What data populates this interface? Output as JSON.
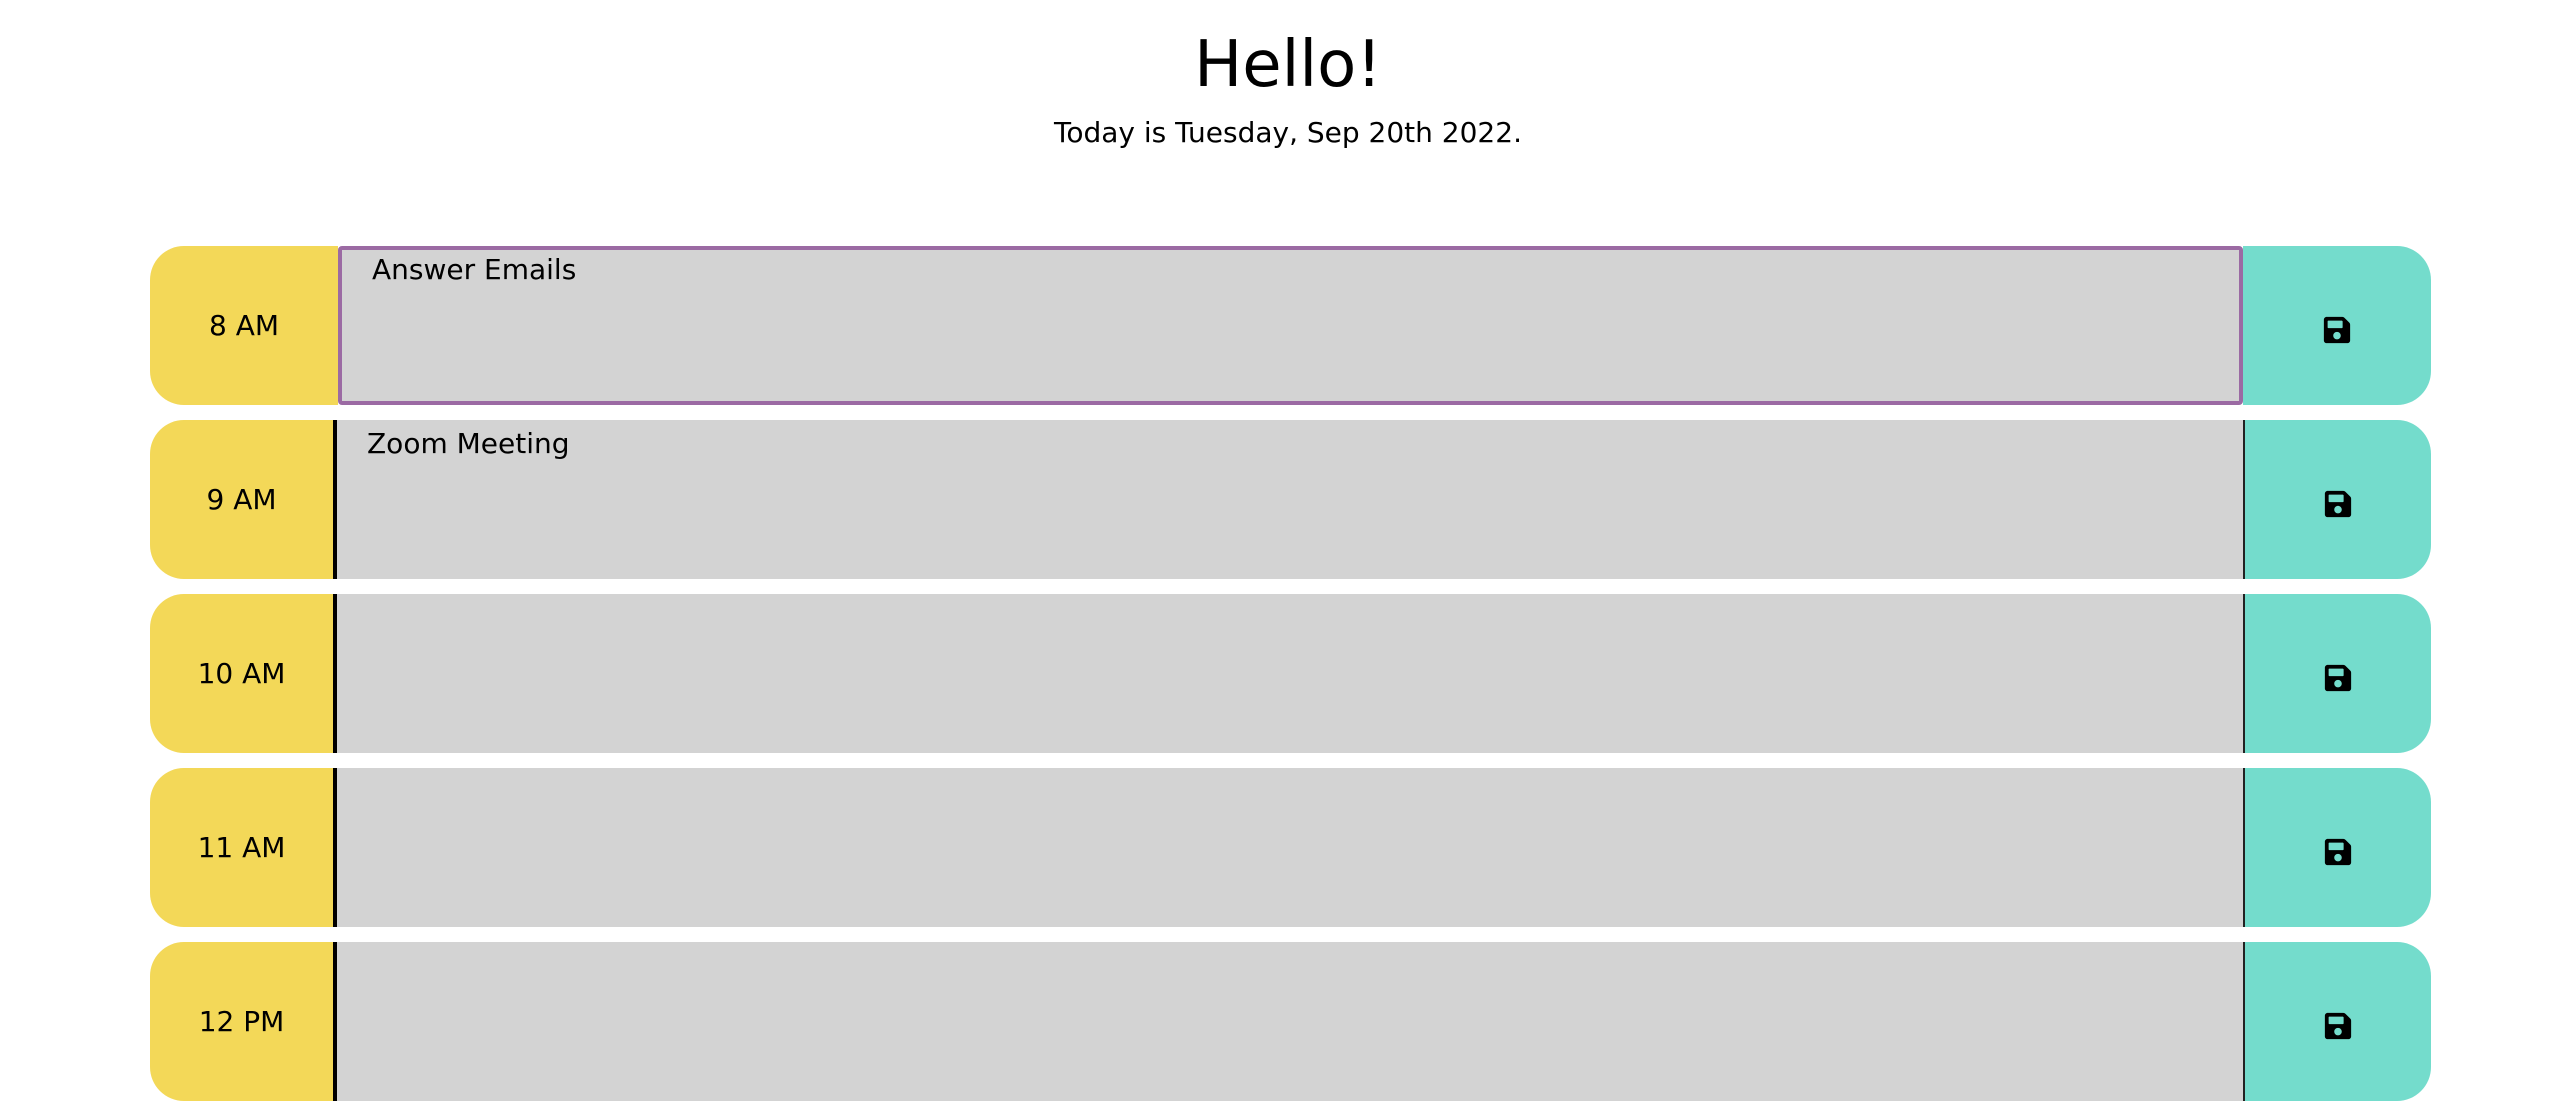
{
  "header": {
    "title": "Hello!",
    "date_text": "Today is Tuesday, Sep 20th 2022."
  },
  "timeblocks": [
    {
      "hour": "8 AM",
      "text": "Answer Emails",
      "state": "active"
    },
    {
      "hour": "9 AM",
      "text": "Zoom Meeting",
      "state": ""
    },
    {
      "hour": "10 AM",
      "text": "",
      "state": ""
    },
    {
      "hour": "11 AM",
      "text": "",
      "state": ""
    },
    {
      "hour": "12 PM",
      "text": "",
      "state": ""
    }
  ],
  "icons": {
    "save": "floppy-disk-icon"
  },
  "colors": {
    "hour_bg": "#f3d858",
    "text_bg": "#d3d3d3",
    "save_bg": "#74dccc",
    "focus_border": "#9b6aa3"
  }
}
